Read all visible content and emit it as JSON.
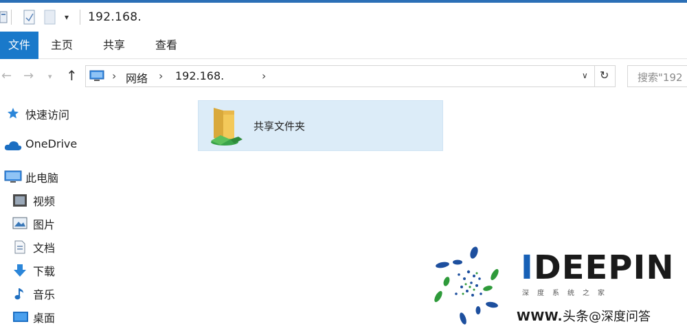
{
  "window": {
    "title": "192.168.",
    "qat_dropdown": "▾"
  },
  "ribbon": {
    "tabs": [
      {
        "label": "文件",
        "active": true
      },
      {
        "label": "主页",
        "active": false
      },
      {
        "label": "共享",
        "active": false
      },
      {
        "label": "查看",
        "active": false
      }
    ]
  },
  "nav": {
    "back": "←",
    "forward": "→",
    "recent": "▾",
    "up": "↑"
  },
  "address": {
    "crumbs": [
      "网络",
      "192.168."
    ],
    "separator": "›",
    "dropdown": "∨",
    "refresh": "↻"
  },
  "search": {
    "placeholder": "搜索\"192"
  },
  "sidebar": {
    "items": [
      {
        "label": "快速访问",
        "icon": "star-icon"
      },
      {
        "label": "OneDrive",
        "icon": "cloud-icon"
      },
      {
        "label": "此电脑",
        "icon": "computer-icon"
      },
      {
        "label": "视频",
        "icon": "video-icon"
      },
      {
        "label": "图片",
        "icon": "picture-icon"
      },
      {
        "label": "文档",
        "icon": "document-icon"
      },
      {
        "label": "下载",
        "icon": "download-icon"
      },
      {
        "label": "音乐",
        "icon": "music-icon"
      },
      {
        "label": "桌面",
        "icon": "desktop-icon"
      }
    ]
  },
  "main": {
    "folders": [
      {
        "label": "共享文件夹",
        "icon": "shared-folder-icon"
      }
    ]
  },
  "watermark": {
    "brand": "IDEEPIN",
    "brand_first": "I",
    "brand_rest": "DEEPIN",
    "sub": "深度系统之家",
    "site_prefix": "WWW.",
    "tt": "头条",
    "handle": "@深度问答"
  },
  "colors": {
    "accent": "#1979ca",
    "selection": "#dcecf8",
    "brand_blue": "#1760b6",
    "brand_green": "#2e9a3a"
  }
}
